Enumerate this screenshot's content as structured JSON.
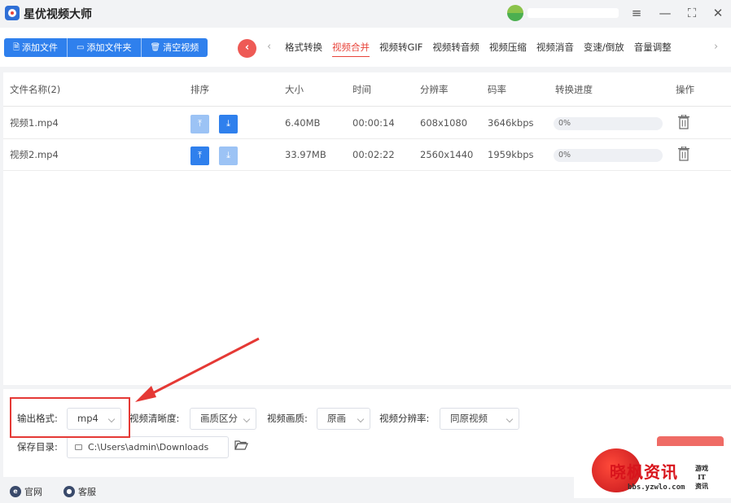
{
  "app": {
    "title": "星优视频大师"
  },
  "window_controls": {
    "menu_icon": "≡",
    "minimize_icon": "—",
    "maximize_icon": "⛶",
    "close_icon": "✕"
  },
  "toolbar": {
    "buttons": [
      {
        "label": "添加文件",
        "icon": "file-icon"
      },
      {
        "label": "添加文件夹",
        "icon": "folder-icon"
      },
      {
        "label": "清空视频",
        "icon": "trash-icon"
      }
    ],
    "tabs": [
      "格式转换",
      "视频合并",
      "视频转GIF",
      "视频转音频",
      "视频压缩",
      "视频消音",
      "变速/倒放",
      "音量调整"
    ],
    "active_tab": "视频合并"
  },
  "table": {
    "headers": {
      "name": "文件名称(2)",
      "order": "排序",
      "size": "大小",
      "time": "时间",
      "resolution": "分辨率",
      "bitrate": "码率",
      "progress": "转换进度",
      "action": "操作"
    },
    "rows": [
      {
        "name": "视频1.mp4",
        "size": "6.40MB",
        "time": "00:00:14",
        "resolution": "608x1080",
        "bitrate": "3646kbps",
        "progress": "0%"
      },
      {
        "name": "视频2.mp4",
        "size": "33.97MB",
        "time": "00:02:22",
        "resolution": "2560x1440",
        "bitrate": "1959kbps",
        "progress": "0%"
      }
    ]
  },
  "settings": {
    "output_format_label": "输出格式:",
    "output_format_value": "mp4",
    "clarity_label": "视频清晰度:",
    "clarity_value": "画质区分",
    "quality_label": "视频画质:",
    "quality_value": "原画",
    "resolution_label": "视频分辨率:",
    "resolution_value": "同原视频",
    "save_dir_label": "保存目录:",
    "save_dir_value": "C:\\Users\\admin\\Downloads"
  },
  "footer": {
    "website": "官网",
    "support": "客服"
  },
  "watermark": {
    "title": "晓枫资讯",
    "url": "bbs.yzwlo.com",
    "side": "游戏 IT 资讯"
  },
  "colors": {
    "primary": "#2f80ed",
    "accent": "#e8443a",
    "highlight": "#e53935"
  }
}
